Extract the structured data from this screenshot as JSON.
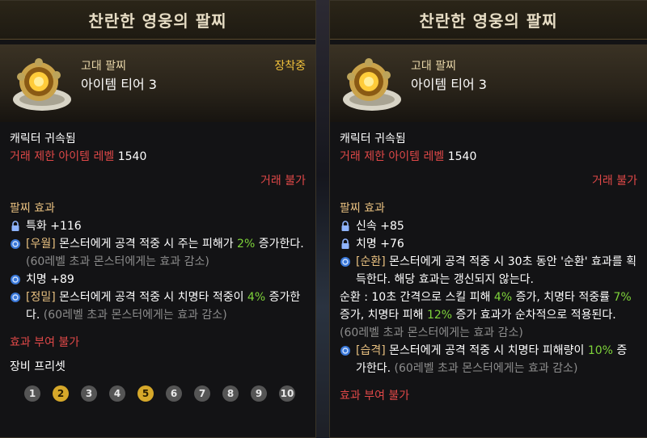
{
  "left": {
    "title": "찬란한 영웅의 팔찌",
    "grade": "고대 팔찌",
    "tier": "아이템 티어 3",
    "equipped": "장착중",
    "bound": "캐릭터 귀속됨",
    "trade_level_label": "거래 제한 아이템 레벨",
    "trade_level_value": "1540",
    "trade": "거래 불가",
    "effects_title": "팔찌 효과",
    "e1": "특화 +116",
    "e2_tag": "[우월]",
    "e2_text": " 몬스터에게 공격 적중 시 주는 피해가 ",
    "e2_val": "2%",
    "e2_tail": " 증가한다.",
    "e2_note": " (60레벨 초과 몬스터에게는 효과 감소)",
    "e3": "치명 +89",
    "e4_tag": "[정밀]",
    "e4_text": " 몬스터에게 공격 적중 시 치명타 적중이 ",
    "e4_val": "4%",
    "e4_tail": " 증가한다.",
    "e4_note": " (60레벨 초과 몬스터에게는 효과 감소)",
    "enchant": "효과 부여 불가",
    "preset_label": "장비 프리셋",
    "presets": [
      "1",
      "2",
      "3",
      "4",
      "5",
      "6",
      "7",
      "8",
      "9",
      "10"
    ],
    "preset_active": [
      "2",
      "5"
    ]
  },
  "right": {
    "title": "찬란한 영웅의 팔찌",
    "grade": "고대 팔찌",
    "tier": "아이템 티어 3",
    "bound": "캐릭터 귀속됨",
    "trade_level_label": "거래 제한 아이템 레벨",
    "trade_level_value": "1540",
    "trade": "거래 불가",
    "effects_title": "팔찌 효과",
    "e1": "신속 +85",
    "e2": "치명 +76",
    "e3_tag": "[순환]",
    "e3_text": " 몬스터에게 공격 적중 시 30초 동안 '순환' 효과를 획득한다. 해당 효과는 갱신되지 않는다.",
    "e3_l1": "순환 : 10초 간격으로 스킬 피해 ",
    "e3_v1": "4%",
    "e3_l2": " 증가, 치명타 적중률 ",
    "e3_v2": "7%",
    "e3_l3": " 증가, 치명타 피해 ",
    "e3_v3": "12%",
    "e3_l4": " 증가 효과가 순차적으로 적용된다.",
    "e3_note": " (60레벨 초과 몬스터에게는 효과 감소)",
    "e4_tag": "[습격]",
    "e4_text": " 몬스터에게 공격 적중 시 치명타 피해량이 ",
    "e4_val": "10%",
    "e4_tail": " 증가한다.",
    "e4_note": " (60레벨 초과 몬스터에게는 효과 감소)",
    "enchant": "효과 부여 불가"
  },
  "colors": {
    "accent_gold": "#f2c23c",
    "restriction_red": "#e04848",
    "value_green": "#7ed33a",
    "note_gray": "#8c8c8c",
    "tag_gold": "#e8c080"
  },
  "icons": [
    "bracelet-icon",
    "lock-icon",
    "swirl-icon"
  ]
}
